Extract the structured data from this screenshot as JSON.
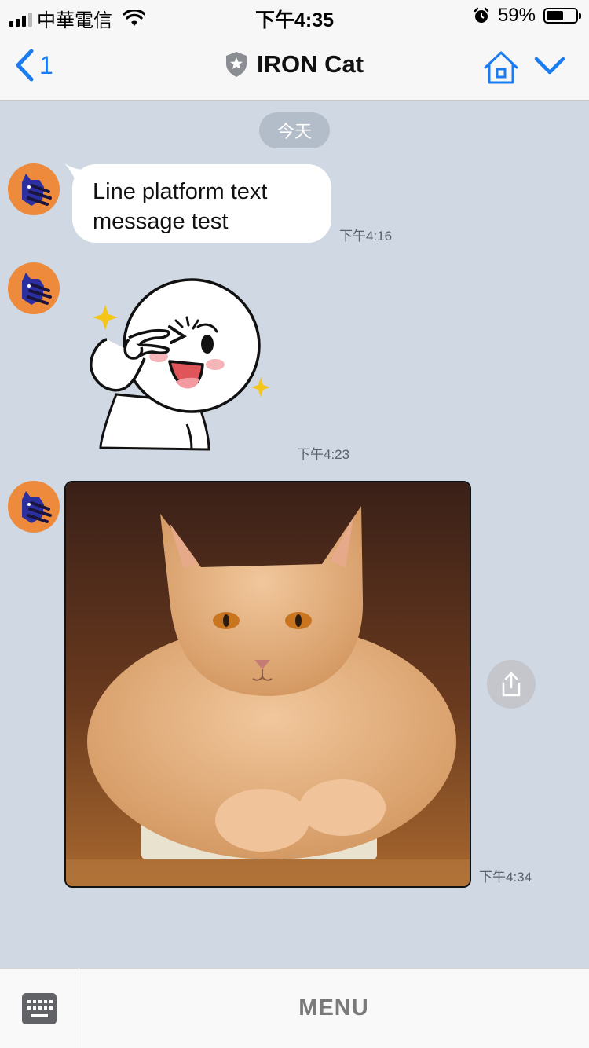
{
  "status_bar": {
    "carrier": "中華電信",
    "time": "下午4:35",
    "battery": "59%",
    "battery_level": 0.59,
    "icons": [
      "signal-icon",
      "wifi-icon",
      "alarm-icon",
      "battery-icon"
    ]
  },
  "nav": {
    "back_count": "1",
    "title": "IRON Cat",
    "icons": [
      "back-chevron-icon",
      "shield-star-icon",
      "home-icon",
      "chevron-down-icon"
    ]
  },
  "chat": {
    "date_label": "今天",
    "messages": [
      {
        "type": "text",
        "text_line1": "Line platform text",
        "text_line2": "message test",
        "time": "下午4:16"
      },
      {
        "type": "sticker",
        "time": "下午4:23"
      },
      {
        "type": "image",
        "time": "下午4:34"
      }
    ]
  },
  "bottom_bar": {
    "menu_label": "MENU",
    "icons": [
      "keyboard-icon"
    ]
  },
  "colors": {
    "chat_background": "#cfd8e3",
    "accent": "#1b7cf2",
    "avatar": "#ed8a3c"
  }
}
